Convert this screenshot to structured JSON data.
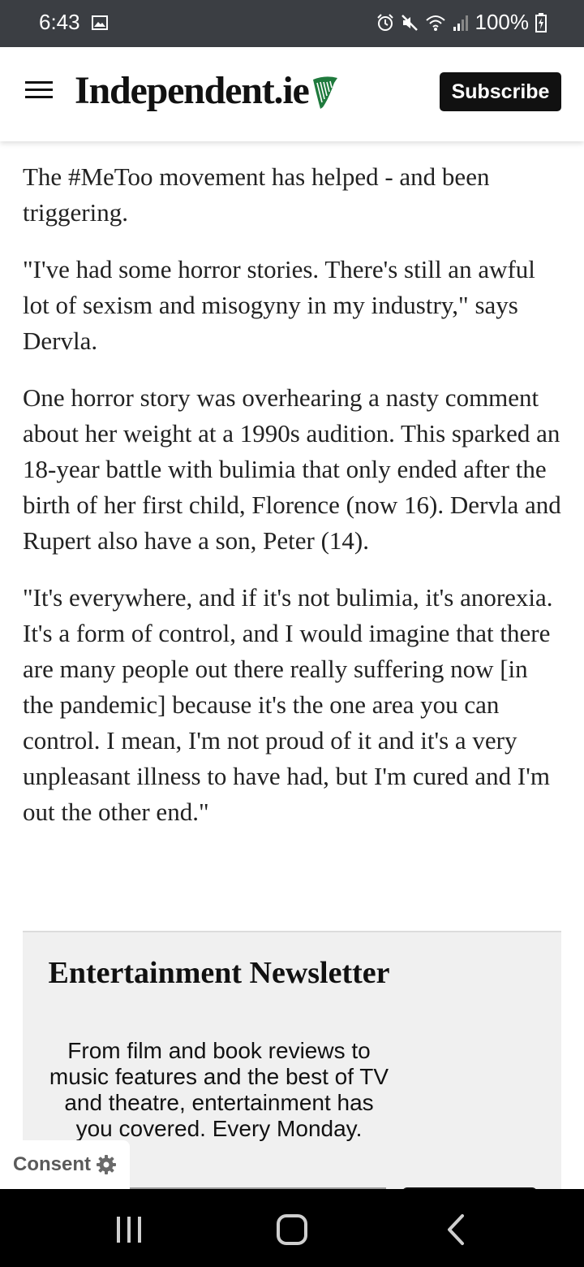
{
  "status_bar": {
    "time": "6:43",
    "battery": "100%",
    "icons": [
      "gallery-icon",
      "alarm-icon",
      "mute-icon",
      "wifi-icon",
      "signal-icon",
      "battery-charging-icon"
    ]
  },
  "header": {
    "menu_icon": "hamburger-menu-icon",
    "logo_text": "Independent.ie",
    "logo_icon": "harp-icon",
    "subscribe_label": "Subscribe"
  },
  "article": {
    "paragraphs": [
      "The #MeToo movement has helped - and been triggering.",
      "\"I've had some horror stories. There's still an awful lot of sexism and misogyny in my industry,\" says Dervla.",
      "One horror story was overhearing a nasty comment about her weight at a 1990s audition. This sparked an 18-year battle with bulimia that only ended after the birth of her first child, Florence (now 16). Dervla and Rupert also have a son, Peter (14).",
      "\"It's everywhere, and if it's not bulimia, it's anorexia. It's a form of control, and I would imagine that there are many people out there really suffering now [in the pandemic] because it's the one area you can control. I mean, I'm not proud of it and it's a very unpleasant illness to have had, but I'm cured and I'm out the other end.\""
    ]
  },
  "newsletter": {
    "title": "Entertainment Newsletter",
    "description": "From film and book reviews to music features and the best of TV and theatre, entertainment has you covered. Every Monday."
  },
  "consent": {
    "label": "Consent",
    "icon": "gear-icon"
  },
  "nav_bar": {
    "buttons": [
      "recent-apps-icon",
      "home-icon",
      "back-icon"
    ]
  },
  "colors": {
    "status_bar_bg": "#3b3e43",
    "brand_green": "#1f7a3d",
    "subscribe_bg": "#111111",
    "newsletter_bg": "#f0f0f0"
  }
}
